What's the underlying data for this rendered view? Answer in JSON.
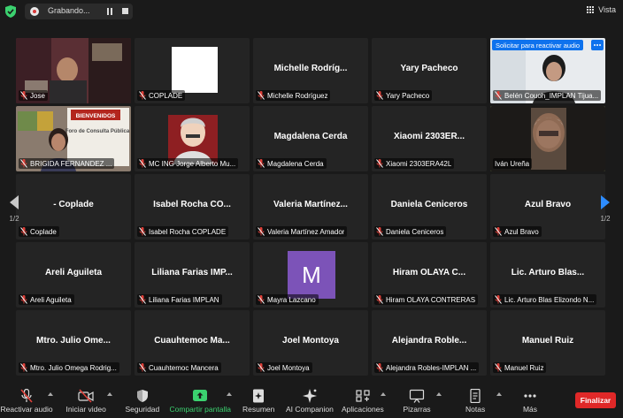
{
  "topbar": {
    "recording_label": "Grabando...",
    "view_label": "Vista"
  },
  "pagination": {
    "left": "1/2",
    "right": "1/2"
  },
  "participants": [
    {
      "title": "",
      "name": "Jose",
      "video": "jose"
    },
    {
      "title": "",
      "name": "COPLADE",
      "video": "white"
    },
    {
      "title": "Michelle  Rodríg...",
      "name": "Michelle Rodríguez"
    },
    {
      "title": "Yary Pacheco",
      "name": "Yary Pacheco"
    },
    {
      "title": "",
      "name": "Belén Couoh_IMPLAN Tijua...",
      "video": "belen",
      "banner": "Solicitar para reactivar audio"
    },
    {
      "title": "",
      "name": "BRIGIDA FERNANDEZ ...",
      "video": "brigida",
      "slide_text": "BIENVENIDOS",
      "slide_sub": "Foro de Consulta Pública"
    },
    {
      "title": "",
      "name": "MC ING Jorge Alberto Mu...",
      "video": "jorge"
    },
    {
      "title": "Magdalena Cerda",
      "name": "Magdalena Cerda"
    },
    {
      "title": "Xiaomi 2303ER...",
      "name": "Xiaomi 2303ERA42L"
    },
    {
      "title": "",
      "name": "Iván Ureña",
      "video": "ivan",
      "active": true,
      "unmuted": true
    },
    {
      "title": "- Coplade",
      "name": "Coplade"
    },
    {
      "title": "Isabel Rocha CO...",
      "name": "Isabel Rocha COPLADE"
    },
    {
      "title": "Valeria  Martínez...",
      "name": "Valeria Martínez Amador"
    },
    {
      "title": "Daniela Ceniceros",
      "name": "Daniela Ceniceros"
    },
    {
      "title": "Azul Bravo",
      "name": "Azul Bravo"
    },
    {
      "title": "Areli Aguileta",
      "name": "Areli Aguileta"
    },
    {
      "title": "Liliana Farias IMP...",
      "name": "Liliana Farias IMPLAN"
    },
    {
      "title": "",
      "name": "Mayra Lazcano",
      "video": "avatar",
      "avatar_letter": "M"
    },
    {
      "title": "Hiram OLAYA C...",
      "name": "Hiram OLAYA CONTRERAS"
    },
    {
      "title": "Lic. Arturo Blas...",
      "name": "Lic. Arturo Blas Elizondo N..."
    },
    {
      "title": "Mtro. Julio Ome...",
      "name": "Mtro. Julio Omega Rodrig..."
    },
    {
      "title": "Cuauhtemoc  Ma...",
      "name": "Cuauhtemoc Mancera"
    },
    {
      "title": "Joel Montoya",
      "name": "Joel Montoya"
    },
    {
      "title": "Alejandra  Roble...",
      "name": "Alejandra Robles-IMPLAN ..."
    },
    {
      "title": "Manuel Ruiz",
      "name": "Manuel Ruiz"
    }
  ],
  "toolbar": [
    {
      "label": "Reactivar audio",
      "icon": "mic-off-icon",
      "caret": true
    },
    {
      "label": "Iniciar video",
      "icon": "video-off-icon",
      "caret": true
    },
    {
      "label": "Seguridad",
      "icon": "shield-icon",
      "caret": false
    },
    {
      "label": "Compartir pantalla",
      "icon": "share-screen-icon",
      "caret": true,
      "highlight": true
    },
    {
      "label": "Resumen",
      "icon": "summary-icon",
      "caret": false
    },
    {
      "label": "AI Companion",
      "icon": "sparkle-icon",
      "caret": false
    },
    {
      "label": "Aplicaciones",
      "icon": "apps-icon",
      "caret": true
    },
    {
      "label": "Pizarras",
      "icon": "whiteboard-icon",
      "caret": true
    },
    {
      "label": "Notas",
      "icon": "notes-icon",
      "caret": true
    },
    {
      "label": "Más",
      "icon": "more-icon",
      "caret": false
    }
  ],
  "end_label": "Finalizar",
  "colors": {
    "accent": "#0e72ed",
    "share_green": "#3bd16f",
    "end_red": "#e02828",
    "active_speaker": "#c7e27c",
    "muted_red": "#e0413a"
  }
}
